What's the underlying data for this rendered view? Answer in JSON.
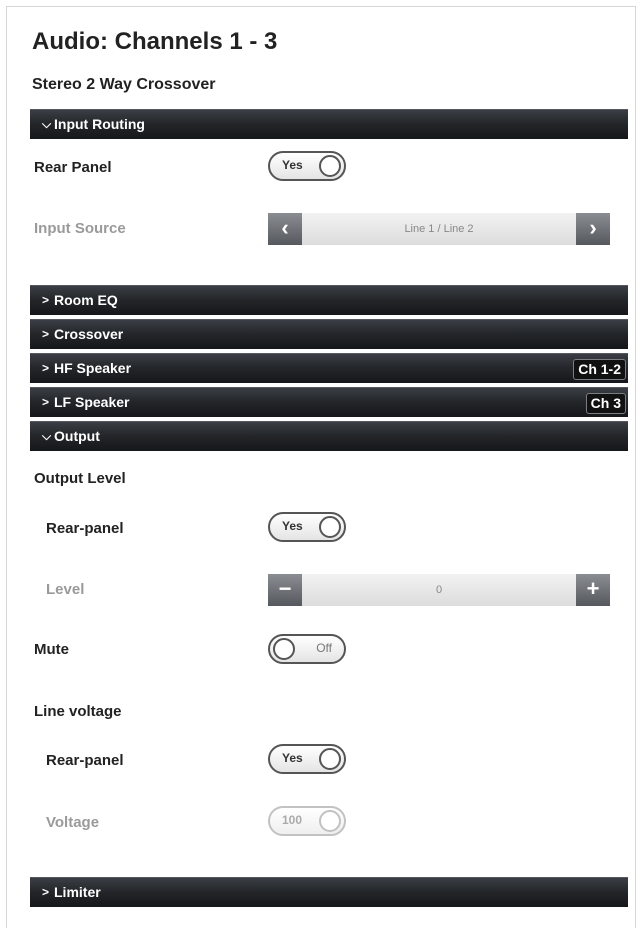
{
  "page": {
    "title": "Audio: Channels 1 - 3",
    "subtitle": "Stereo 2 Way Crossover"
  },
  "sections": {
    "input_routing": {
      "label": "Input Routing",
      "expanded": true
    },
    "room_eq": {
      "label": "Room EQ",
      "expanded": false
    },
    "crossover": {
      "label": "Crossover",
      "expanded": false
    },
    "hf_speaker": {
      "label": "HF Speaker",
      "badge": "Ch 1-2",
      "expanded": false
    },
    "lf_speaker": {
      "label": "LF Speaker",
      "badge": "Ch 3",
      "expanded": false
    },
    "output": {
      "label": "Output",
      "expanded": true
    },
    "limiter": {
      "label": "Limiter",
      "expanded": false
    }
  },
  "input_routing": {
    "rear_panel_label": "Rear Panel",
    "rear_panel_value": "Yes",
    "input_source_label": "Input Source",
    "input_source_value": "Line 1 / Line 2"
  },
  "output": {
    "output_level_heading": "Output Level",
    "level_rear_panel_label": "Rear-panel",
    "level_rear_panel_value": "Yes",
    "level_label": "Level",
    "level_value": "0",
    "mute_label": "Mute",
    "mute_value": "Off",
    "line_voltage_heading": "Line voltage",
    "voltage_rear_panel_label": "Rear-panel",
    "voltage_rear_panel_value": "Yes",
    "voltage_label": "Voltage",
    "voltage_value": "100"
  },
  "icons": {
    "expanded": "chevron-down-icon",
    "collapsed": "chevron-right-icon",
    "prev": "chevron-left-icon",
    "next": "chevron-right-icon",
    "minus": "minus-icon",
    "plus": "plus-icon"
  }
}
